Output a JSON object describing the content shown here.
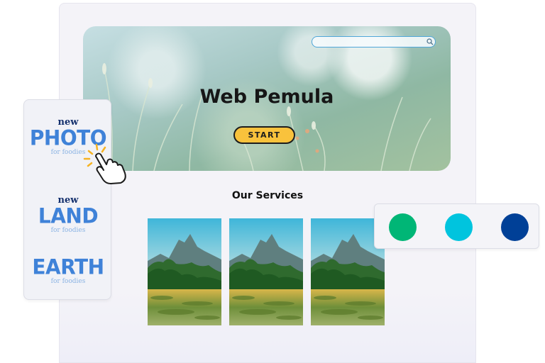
{
  "hero": {
    "title": "Web Pemula",
    "start_label": "START",
    "search_placeholder": ""
  },
  "services": {
    "title": "Our Services",
    "images": [
      "landscape-lake-karst",
      "landscape-lake-karst",
      "landscape-lake-karst"
    ]
  },
  "promos": [
    {
      "new": "new",
      "big": "PHOTO",
      "sub": "for foodies"
    },
    {
      "new": "new",
      "big": "LAND",
      "sub": "for foodies"
    },
    {
      "new": "",
      "big": "EARTH",
      "sub": "for foodies"
    }
  ],
  "colors": {
    "swatches": [
      "#00b676",
      "#00c4de",
      "#004097"
    ],
    "accent": "#f9c23c",
    "promo_blue": "#3f82d8"
  },
  "icons": [
    "search-icon",
    "pointer-hand-icon"
  ]
}
